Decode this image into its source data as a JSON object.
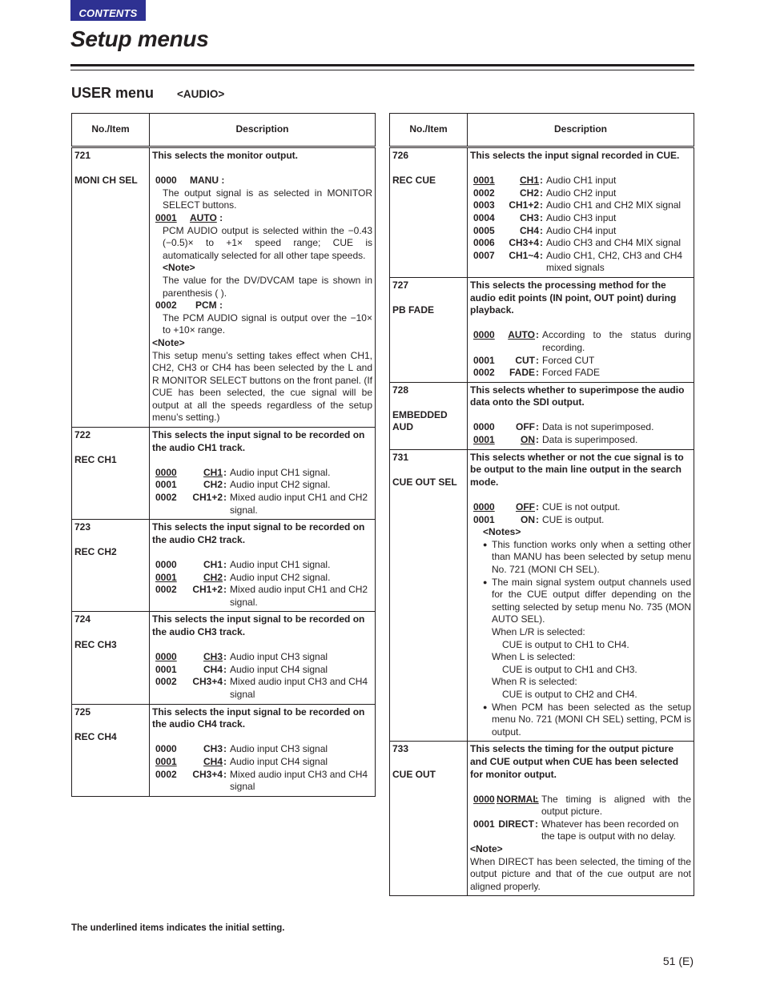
{
  "header": {
    "contents_label": "CONTENTS",
    "title": "Setup menus",
    "section_title": "USER menu",
    "section_subtitle": "<AUDIO>"
  },
  "table_headers": {
    "item": "No./Item",
    "description": "Description"
  },
  "left_table": [
    {
      "no": "721",
      "name": "MONI CH SEL",
      "head": "This selects  the monitor output.",
      "options": [
        {
          "code": "0000",
          "key": "MANU",
          "default": false,
          "text": "The output signal is as selected in MONITOR SELECT buttons."
        },
        {
          "code": "0001",
          "key": "AUTO",
          "default": true,
          "text": "PCM AUDIO output is selected within the −0.43 (−0.5)× to +1× speed range; CUE is automatically selected for all other tape speeds."
        },
        {
          "code": "0002",
          "key": "PCM",
          "default": false,
          "text": "The PCM AUDIO signal is output over the −10× to +10× range."
        }
      ],
      "inner_note_label": "<Note>",
      "inner_note": "The value for the DV/DVCAM tape is shown in parenthesis (    ).",
      "note_label": "<Note>",
      "note": "This setup menu’s setting takes effect when CH1, CH2, CH3 or CH4 has been selected by the L and R MONITOR SELECT buttons on the front panel. (If CUE has been selected, the cue signal will be output at all the speeds regardless of the setup menu’s setting.)"
    },
    {
      "no": "722",
      "name": "REC CH1",
      "head": "This selects the input signal to be recorded on the audio CH1 track.",
      "options": [
        {
          "code": "0000",
          "key": "CH1",
          "default": true,
          "text": "Audio input CH1 signal."
        },
        {
          "code": "0001",
          "key": "CH2",
          "default": false,
          "text": "Audio input CH2 signal."
        },
        {
          "code": "0002",
          "key": "CH1+2",
          "default": false,
          "text": "Mixed audio input CH1 and CH2 signal."
        }
      ]
    },
    {
      "no": "723",
      "name": "REC CH2",
      "head": "This selects the input signal to be recorded on the audio CH2 track.",
      "options": [
        {
          "code": "0000",
          "key": "CH1",
          "default": false,
          "text": "Audio input CH1 signal."
        },
        {
          "code": "0001",
          "key": "CH2",
          "default": true,
          "text": "Audio input CH2 signal."
        },
        {
          "code": "0002",
          "key": "CH1+2",
          "default": false,
          "text": "Mixed audio input CH1 and CH2 signal."
        }
      ]
    },
    {
      "no": "724",
      "name": "REC CH3",
      "head": "This selects the input signal to be recorded on the audio CH3 track.",
      "options": [
        {
          "code": "0000",
          "key": "CH3",
          "default": true,
          "text": "Audio input CH3 signal"
        },
        {
          "code": "0001",
          "key": "CH4",
          "default": false,
          "text": "Audio input CH4 signal"
        },
        {
          "code": "0002",
          "key": "CH3+4",
          "default": false,
          "text": "Mixed audio input CH3 and CH4 signal"
        }
      ]
    },
    {
      "no": "725",
      "name": "REC CH4",
      "head": "This selects the input signal to be recorded on the audio CH4 track.",
      "options": [
        {
          "code": "0000",
          "key": "CH3",
          "default": false,
          "text": "Audio input CH3 signal"
        },
        {
          "code": "0001",
          "key": "CH4",
          "default": true,
          "text": "Audio input CH4 signal"
        },
        {
          "code": "0002",
          "key": "CH3+4",
          "default": false,
          "text": "Mixed audio input CH3 and CH4 signal"
        }
      ]
    }
  ],
  "right_table": [
    {
      "no": "726",
      "name": "REC CUE",
      "head": "This selects the input signal recorded in CUE.",
      "options": [
        {
          "code": "0001",
          "key": "CH1",
          "default": true,
          "text": "Audio CH1 input"
        },
        {
          "code": "0002",
          "key": "CH2",
          "default": false,
          "text": "Audio CH2 input"
        },
        {
          "code": "0003",
          "key": "CH1+2",
          "default": false,
          "text": "Audio CH1 and CH2 MIX signal"
        },
        {
          "code": "0004",
          "key": "CH3",
          "default": false,
          "text": "Audio CH3 input"
        },
        {
          "code": "0005",
          "key": "CH4",
          "default": false,
          "text": "Audio CH4 input"
        },
        {
          "code": "0006",
          "key": "CH3+4",
          "default": false,
          "text": "Audio CH3 and CH4 MIX signal"
        },
        {
          "code": "0007",
          "key": "CH1~4",
          "default": false,
          "text": "Audio CH1, CH2, CH3 and CH4 mixed signals"
        }
      ]
    },
    {
      "no": "727",
      "name": "PB FADE",
      "head": "This selects the processing method for the audio edit points (IN point, OUT point) during playback.",
      "options": [
        {
          "code": "0000",
          "key": "AUTO",
          "default": true,
          "text": "According to the status during recording."
        },
        {
          "code": "0001",
          "key": "CUT",
          "default": false,
          "text": "Forced CUT"
        },
        {
          "code": "0002",
          "key": "FADE",
          "default": false,
          "text": "Forced FADE"
        }
      ]
    },
    {
      "no": "728",
      "name": "EMBEDDED AUD",
      "head": "This selects whether to superimpose the audio data onto the SDI output.",
      "options": [
        {
          "code": "0000",
          "key": "OFF",
          "default": false,
          "text": "Data is not superimposed."
        },
        {
          "code": "0001",
          "key": "ON",
          "default": true,
          "text": "Data is superimposed."
        }
      ]
    },
    {
      "no": "731",
      "name": "CUE OUT SEL",
      "head": "This selects whether or not the cue signal is to be output to the main line output in the search mode.",
      "options": [
        {
          "code": "0000",
          "key": "OFF",
          "default": true,
          "text": "CUE is not output."
        },
        {
          "code": "0001",
          "key": "ON",
          "default": false,
          "text": "CUE is output."
        }
      ],
      "notes_label": "<Notes>",
      "notes": [
        "This function works only when a setting other than MANU has been selected by setup menu No. 721 (MONI CH SEL).",
        "The main signal system output channels used for the CUE output differ depending on the setting selected by setup menu No. 735 (MON AUTO SEL).",
        "When PCM has been selected as the setup menu No. 721 (MONI CH SEL) setting, PCM is output."
      ],
      "sub_notes": [
        {
          "when": "When L/R is selected:",
          "result": "CUE is output to CH1 to CH4."
        },
        {
          "when": "When L is selected:",
          "result": "CUE is output to CH1 and CH3."
        },
        {
          "when": "When R is selected:",
          "result": "CUE is output to CH2 and CH4."
        }
      ]
    },
    {
      "no": "733",
      "name": "CUE OUT",
      "head": "This selects the timing for the output picture and CUE output when CUE has been selected for monitor output.",
      "options": [
        {
          "code": "0000",
          "key": "NORMAL",
          "default": true,
          "text": "The timing is aligned with the output picture."
        },
        {
          "code": "0001",
          "key": "DIRECT",
          "default": false,
          "text": "Whatever has been recorded on the tape is output with no delay."
        }
      ],
      "note_label": "<Note>",
      "note": "When DIRECT has been selected, the timing of the output picture and that of the cue output are not aligned properly."
    }
  ],
  "footnote": "The underlined items indicates the initial setting.",
  "page_number": "51 (E)",
  "colors": {
    "contents_badge": "#2e3192",
    "text": "#231f20"
  }
}
